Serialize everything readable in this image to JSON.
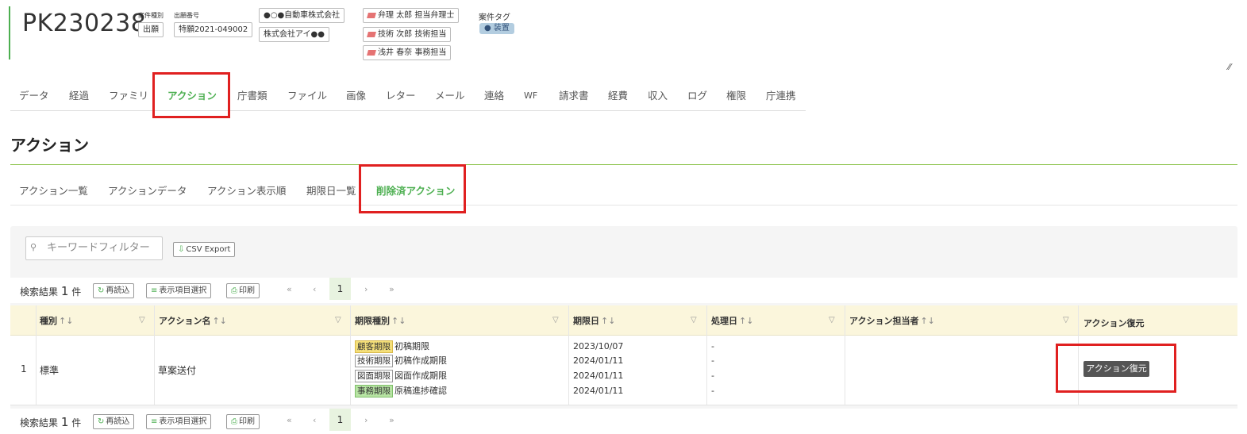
{
  "header": {
    "case_number": "PK230238",
    "case_type_label": "案件種別",
    "case_type_value": "出願",
    "application_no_label": "出願番号",
    "application_no_value": "特願2021-049002",
    "clients": [
      "●○●自動車株式会社",
      "株式会社アイ●●"
    ],
    "staff": [
      "弁理 太郎 担当弁理士",
      "技術 次郎 技術担当",
      "浅井 春奈 事務担当"
    ],
    "case_tag_label": "案件タグ",
    "case_tag_value": "装置"
  },
  "main_tabs": [
    "データ",
    "経過",
    "ファミリ",
    "アクション",
    "庁書類",
    "ファイル",
    "画像",
    "レター",
    "メール",
    "連絡",
    "WF",
    "請求書",
    "経費",
    "収入",
    "ログ",
    "権限",
    "庁連携"
  ],
  "active_main_tab": "アクション",
  "section_title": "アクション",
  "sub_tabs": [
    "アクション一覧",
    "アクションデータ",
    "アクション表示順",
    "期限日一覧",
    "削除済アクション"
  ],
  "active_sub_tab": "削除済アクション",
  "toolbar": {
    "search_placeholder": "キーワードフィルター",
    "csv_export": "CSV Export"
  },
  "results": {
    "prefix": "検索結果",
    "count": "1",
    "suffix": "件",
    "reload": "再読込",
    "columns_select": "表示項目選択",
    "print": "印刷"
  },
  "pagination": {
    "first": "«",
    "prev": "‹",
    "current": "1",
    "next": "›",
    "last": "»"
  },
  "table": {
    "headers": [
      "種別",
      "アクション名",
      "期限種別",
      "期限日",
      "処理日",
      "アクション担当者",
      "アクション復元"
    ],
    "sort_symbol": "↑↓",
    "row": {
      "index": "1",
      "type": "標準",
      "action_name": "草案送付",
      "deadlines": [
        {
          "badge": "顧客期限",
          "badge_color": "#f5e07a",
          "name": "初稿期限",
          "date": "2023/10/07",
          "processed": "-"
        },
        {
          "badge": "技術期限",
          "badge_color": "#ffffff",
          "name": "初稿作成期限",
          "date": "2024/01/11",
          "processed": "-"
        },
        {
          "badge": "図面期限",
          "badge_color": "#ffffff",
          "name": "図面作成期限",
          "date": "2024/01/11",
          "processed": "-"
        },
        {
          "badge": "事務期限",
          "badge_color": "#b7e4a3",
          "name": "原稿進捗確認",
          "date": "2024/01/11",
          "processed": "-"
        }
      ],
      "restore_button": "アクション復元"
    }
  },
  "colors": {
    "accent_green": "#4caf50",
    "highlight_red": "#e02020",
    "header_row_bg": "#fbf6dc"
  }
}
